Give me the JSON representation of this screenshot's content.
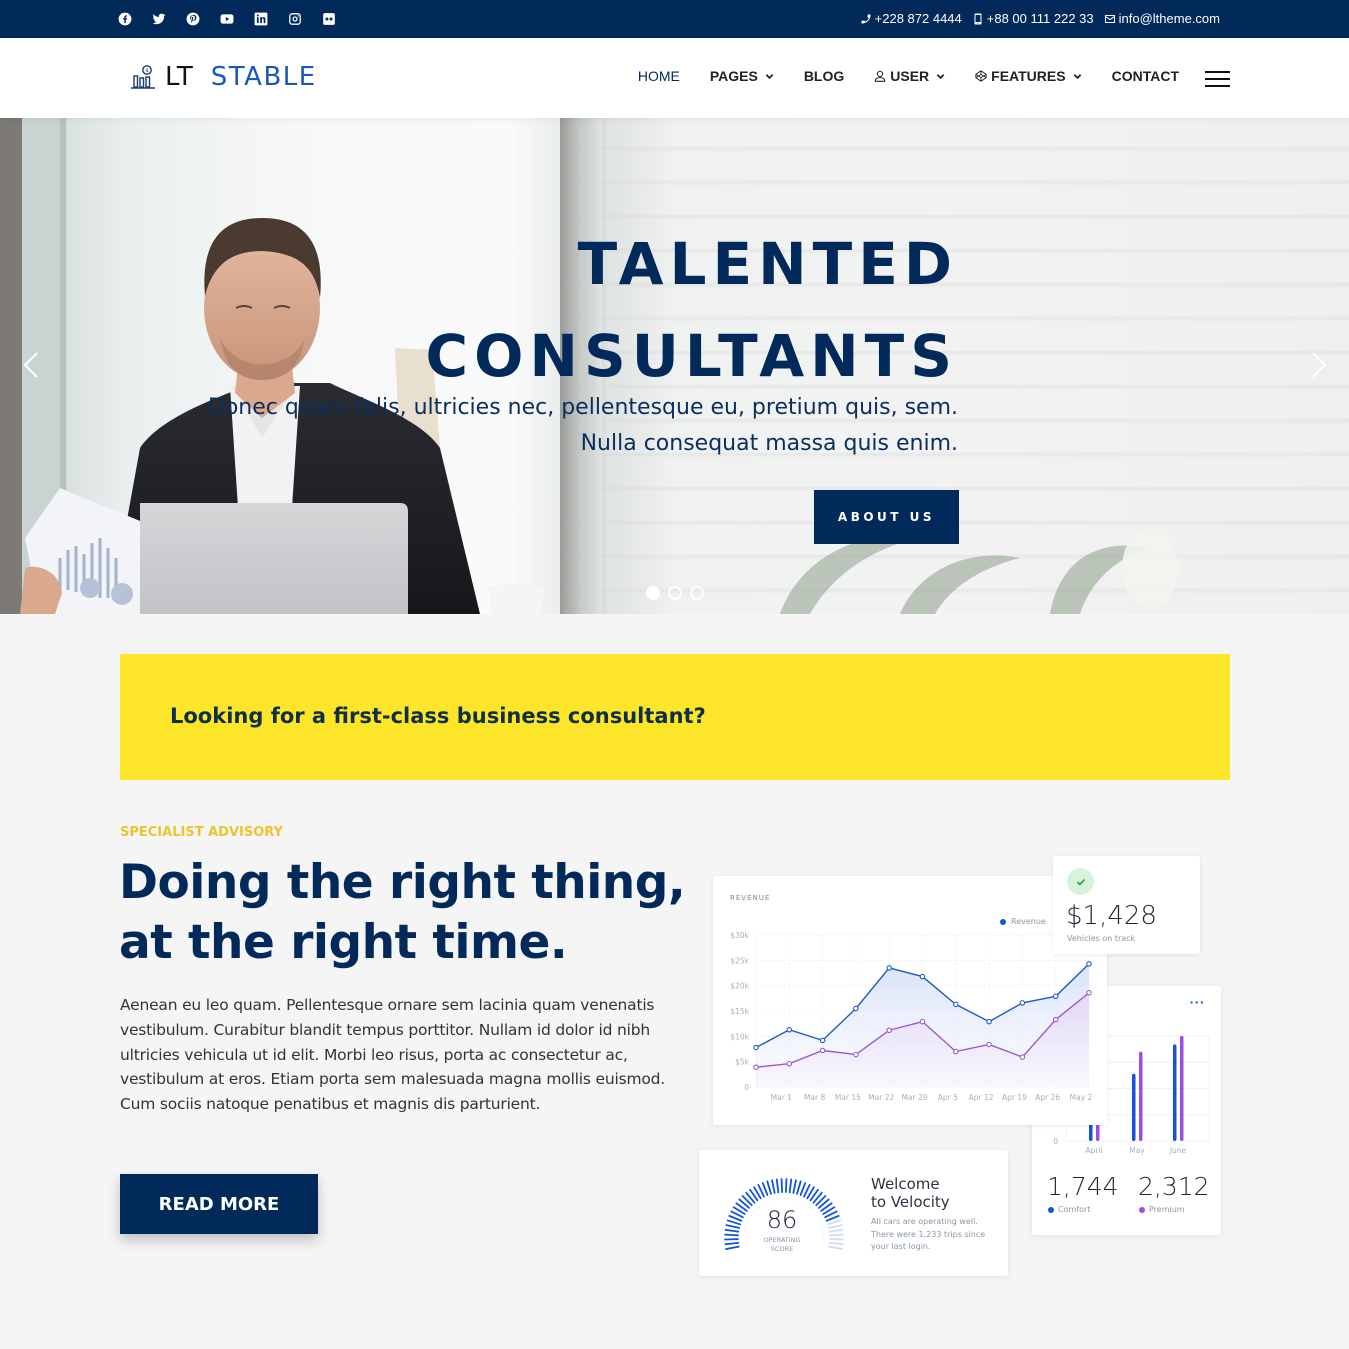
{
  "topbar": {
    "social": [
      {
        "name": "facebook-icon"
      },
      {
        "name": "twitter-icon"
      },
      {
        "name": "pinterest-icon"
      },
      {
        "name": "youtube-icon"
      },
      {
        "name": "linkedin-icon"
      },
      {
        "name": "instagram-icon"
      },
      {
        "name": "flickr-icon"
      }
    ],
    "phone": "+228 872 4444",
    "mobile": "+88 00 111 222 33",
    "email": "info@ltheme.com"
  },
  "header": {
    "logo_lt": "LT",
    "logo_stable": "STABLE",
    "nav": [
      {
        "label": "HOME",
        "active": true
      },
      {
        "label": "PAGES",
        "dropdown": true
      },
      {
        "label": "BLOG"
      },
      {
        "label": "USER",
        "dropdown": true,
        "icon": "user-icon"
      },
      {
        "label": "FEATURES",
        "dropdown": true,
        "icon": "codepen-icon"
      },
      {
        "label": "CONTACT"
      }
    ]
  },
  "hero": {
    "title_line1": "TALENTED",
    "title_line2": "CONSULTANTS",
    "subtitle_line1": "Donec quam felis, ultricies nec, pellentesque eu, pretium quis, sem.",
    "subtitle_line2": "Nulla consequat massa quis enim.",
    "button": "ABOUT US",
    "slides": 3,
    "active_slide": 1
  },
  "banner": {
    "text": "Looking for a first-class business consultant?"
  },
  "advisory": {
    "eyebrow": "SPECIALIST ADVISORY",
    "headline_line1": "Doing the right thing,",
    "headline_line2": "at the right time.",
    "body": "Aenean eu leo quam. Pellentesque ornare sem lacinia quam venenatis vestibulum. Curabitur blandit tempus porttitor. Nullam id dolor id nibh ultricies vehicula ut id elit. Morbi leo risus, porta ac consectetur ac, vestibulum at eros. Etiam porta sem malesuada magna mollis euismod. Cum sociis natoque penatibus et magnis dis parturient.",
    "button": "READ MORE"
  },
  "dashboard": {
    "revenue": {
      "title": "REVENUE",
      "legend": "Revenue",
      "y_ticks": [
        "0",
        "$5k",
        "$10k",
        "$15k",
        "$20k",
        "$25k",
        "$30k"
      ],
      "x_ticks": [
        "Mar 1",
        "Mar 8",
        "Mar 15",
        "Mar 22",
        "Mar 29",
        "Apr 5",
        "Apr 12",
        "Apr 19",
        "Apr 26",
        "May 2"
      ],
      "series_blue": [
        7800,
        11300,
        9200,
        15500,
        23500,
        21800,
        16300,
        12900,
        16600,
        17900,
        24300
      ],
      "series_purple": [
        3900,
        4600,
        7200,
        6400,
        11200,
        12900,
        7000,
        8400,
        5900,
        13300,
        18600
      ],
      "ymax": 30000,
      "colors": {
        "blue": "#1e5bc6",
        "purple": "#9b59d0"
      }
    },
    "stat": {
      "value": "$1,428",
      "label": "Vehicles on track"
    },
    "bars": {
      "more": "···",
      "y_zero": "0",
      "categories": [
        "April",
        "May",
        "June"
      ],
      "comfort": [
        0.28,
        0.64,
        0.92
      ],
      "premium": [
        0.34,
        0.85,
        1.0
      ],
      "comfort_value": "1,744",
      "comfort_label": "Comfort",
      "premium_value": "2,312",
      "premium_label": "Premium",
      "colors": {
        "comfort": "#1553d6",
        "premium": "#9b4ee0"
      }
    },
    "gauge": {
      "score": "86",
      "label_line1": "OPERATING",
      "label_line2": "SCORE",
      "fraction": 0.86,
      "title_line1": "Welcome",
      "title_line2": "to Velocity",
      "text": "All cars are operating well. There were 1,233 trips since your last login."
    }
  }
}
